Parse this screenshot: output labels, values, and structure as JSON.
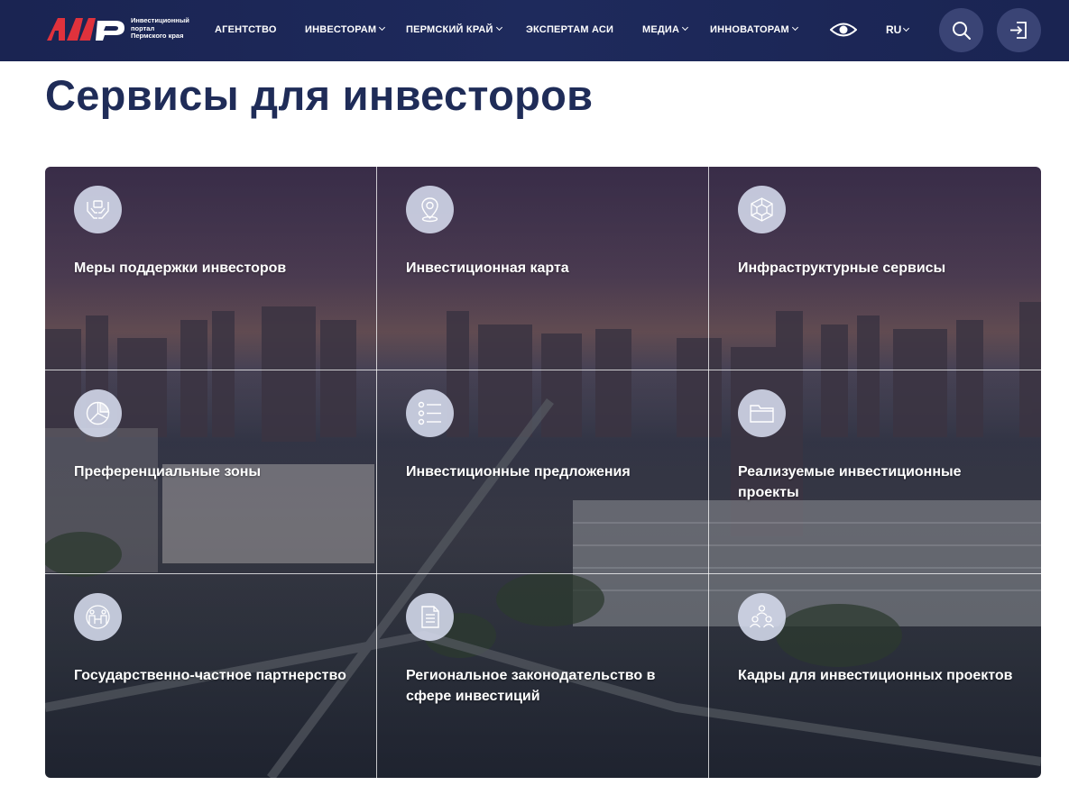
{
  "header": {
    "logo_lines": [
      "Инвестиционный",
      "портал",
      "Пермского края"
    ],
    "nav": [
      {
        "label": "АГЕНТСТВО",
        "has_dropdown": false
      },
      {
        "label": "ИНВЕСТОРАМ",
        "has_dropdown": true
      },
      {
        "label": "ПЕРМСКИЙ КРАЙ",
        "has_dropdown": true
      },
      {
        "label": "ЭКСПЕРТАМ АСИ",
        "has_dropdown": false
      },
      {
        "label": "МЕДИА",
        "has_dropdown": true
      },
      {
        "label": "ИННОВАТОРАМ",
        "has_dropdown": true
      }
    ],
    "language": "RU",
    "icons": [
      "eye-icon",
      "search-icon",
      "login-icon"
    ],
    "colors": {
      "bar": "#1e2a5c",
      "button": "#3a4475",
      "logo_red": "#e0323c"
    }
  },
  "page_title": "Сервисы для инвесторов",
  "services": [
    {
      "label": "Меры поддержки инвесторов",
      "icon": "hands-icon"
    },
    {
      "label": "Инвестиционная карта",
      "icon": "map-pin-icon"
    },
    {
      "label": "Инфраструктурные сервисы",
      "icon": "network-cube-icon"
    },
    {
      "label": "Преференциальные зоны",
      "icon": "pie-chart-icon"
    },
    {
      "label": "Инвестиционные предложения",
      "icon": "list-icon"
    },
    {
      "label": "Реализуемые инвестиционные проекты",
      "icon": "folder-icon"
    },
    {
      "label": "Государственно-частное партнерство",
      "icon": "partnership-icon"
    },
    {
      "label": "Региональное законодательство в сфере инвестиций",
      "icon": "document-icon"
    },
    {
      "label": "Кадры для инвестиционных проектов",
      "icon": "team-icon"
    }
  ]
}
